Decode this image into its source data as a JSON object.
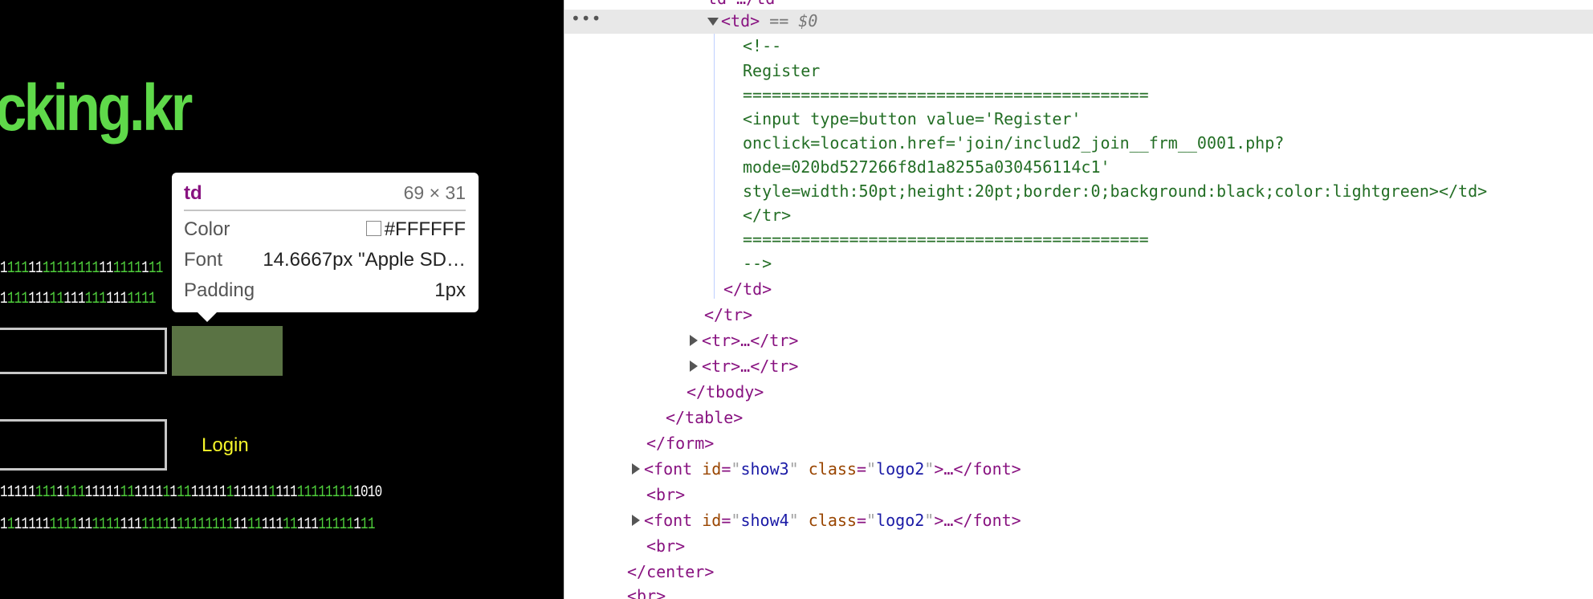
{
  "page": {
    "logo_text": "cking.kr",
    "binary_rows": [
      [
        [
          "b",
          "1"
        ],
        [
          "g",
          "111"
        ],
        [
          "b",
          "11"
        ],
        [
          "g",
          "11111111"
        ],
        [
          "b",
          "11"
        ],
        [
          "g",
          "1111"
        ],
        [
          "b",
          "1"
        ],
        [
          "g",
          "11"
        ]
      ],
      [
        [
          "b",
          "1"
        ],
        [
          "g",
          "111"
        ],
        [
          "b",
          "111"
        ],
        [
          "g",
          "11"
        ],
        [
          "b",
          "111"
        ],
        [
          "g",
          "111"
        ],
        [
          "b",
          "111"
        ],
        [
          "g",
          "1111"
        ]
      ],
      [
        [
          "b",
          "11111"
        ],
        [
          "g",
          "111"
        ],
        [
          "b",
          "1"
        ],
        [
          "g",
          "111"
        ],
        [
          "b",
          "11111"
        ],
        [
          "g",
          "11"
        ],
        [
          "b",
          "1111"
        ],
        [
          "g",
          "1"
        ],
        [
          "b",
          "1"
        ],
        [
          "g",
          "11"
        ],
        [
          "b",
          "11111"
        ],
        [
          "g",
          "1"
        ],
        [
          "b",
          "11111"
        ],
        [
          "g",
          "1"
        ],
        [
          "b",
          "111"
        ],
        [
          "g",
          "11111111"
        ],
        [
          "b",
          "1010"
        ]
      ],
      [
        [
          "b",
          "1"
        ],
        [
          "g",
          "1"
        ],
        [
          "b",
          "11111"
        ],
        [
          "g",
          "1111"
        ],
        [
          "b",
          "11"
        ],
        [
          "g",
          "1111"
        ],
        [
          "b",
          "111"
        ],
        [
          "g",
          "1111"
        ],
        [
          "b",
          "1"
        ],
        [
          "g",
          "11111111"
        ],
        [
          "b",
          "11"
        ],
        [
          "g",
          "11"
        ],
        [
          "b",
          "111"
        ],
        [
          "g",
          "11"
        ],
        [
          "b",
          "111"
        ],
        [
          "g",
          "11111"
        ],
        [
          "b",
          "1"
        ],
        [
          "g",
          "11"
        ]
      ]
    ],
    "login_label": "Login",
    "colors": {
      "logo": "#5fd94a",
      "login": "#f5f52a",
      "highlight": "#5a7344"
    }
  },
  "tooltip": {
    "tag": "td",
    "size": "69 × 31",
    "color_label": "Color",
    "color_value": "#FFFFFF",
    "font_label": "Font",
    "font_value": "14.6667px \"Apple SD…",
    "padding_label": "Padding",
    "padding_value": "1px"
  },
  "devtools": {
    "dots": "•••",
    "selected": {
      "tag_open": "<td>",
      "marker": " == $0"
    },
    "comment_lines": [
      "<!--",
      "Register",
      "==========================================",
      "<input type=button value='Register'",
      "onclick=location.href='join/includ2_join__frm__0001.php?",
      "mode=020bd527266f8d1a8255a030456114c1'",
      "style=width:50pt;height:20pt;border:0;background:black;color:lightgreen></td>",
      "</tr>",
      "==========================================",
      "-->"
    ],
    "close_td": "</td>",
    "close_tr": "</tr>",
    "collapsed_tr": "<tr>…</tr>",
    "close_tbody": "</tbody>",
    "close_table": "</table>",
    "close_form": "</form>",
    "font_tag": "font",
    "font_rows": [
      {
        "id": "show3",
        "class": "logo2"
      },
      {
        "id": "show4",
        "class": "logo2"
      }
    ],
    "ellipsis_close_font": "…</font>",
    "br": "<br>",
    "close_center": "</center>",
    "trailing": "<br>",
    "top_partial": "td …/td"
  }
}
